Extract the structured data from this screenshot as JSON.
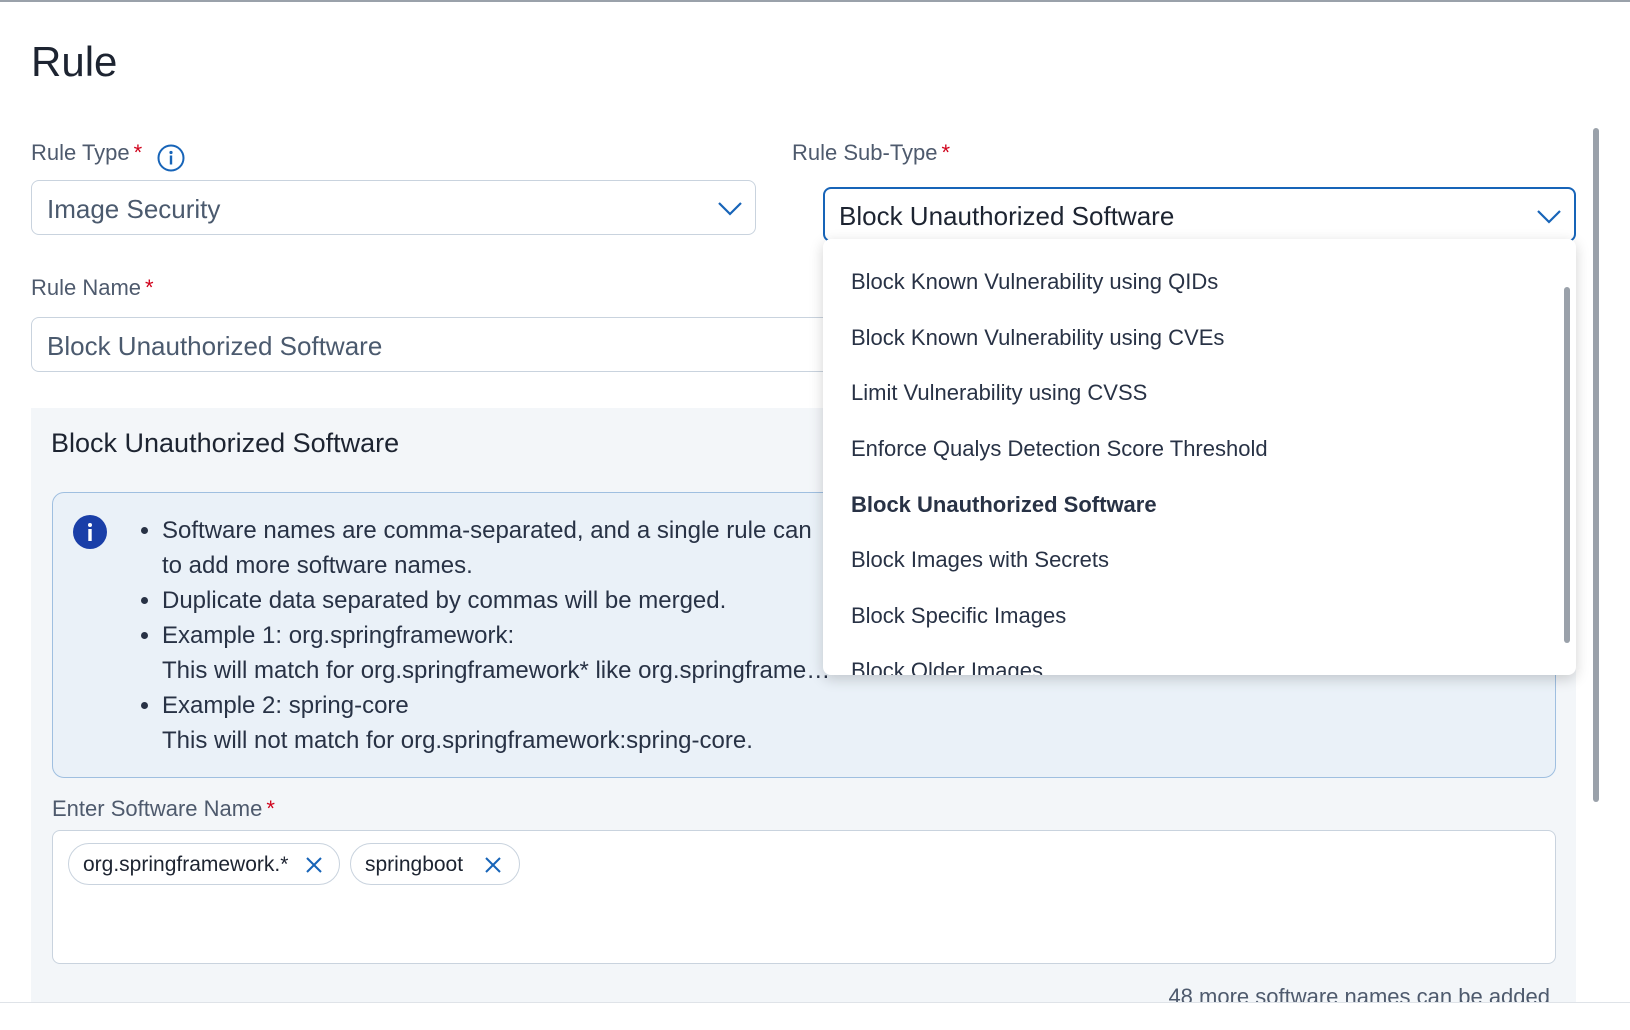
{
  "page": {
    "title": "Rule"
  },
  "rule_type": {
    "label": "Rule Type",
    "required_mark": "*",
    "value": "Image Security"
  },
  "rule_sub_type": {
    "label": "Rule Sub-Type",
    "required_mark": "*",
    "value": "Block Unauthorized Software"
  },
  "rule_name": {
    "label": "Rule Name",
    "required_mark": "*",
    "value": "Block Unauthorized Software"
  },
  "dropdown": {
    "options": [
      "Block Known Vulnerability using QIDs",
      "Block Known Vulnerability using CVEs",
      "Limit Vulnerability using CVSS",
      "Enforce Qualys Detection Score Threshold",
      "Block Unauthorized Software",
      "Block Images with Secrets",
      "Block Specific Images",
      "Block Older Images"
    ],
    "selected": "Block Unauthorized Software"
  },
  "panel": {
    "title": "Block Unauthorized Software",
    "notice_lines": [
      "Software names are comma-separated, and a single rule can",
      "to add more software names.",
      "Duplicate data separated by commas will be merged.",
      "Example 1: org.springframework:",
      "This will match for org.springframework* like org.springframe…",
      "Example 2: spring-core",
      "This will not match for org.springframework:spring-core."
    ]
  },
  "software": {
    "label": "Enter Software Name",
    "required_mark": "*",
    "chips": [
      "org.springframework.*",
      "springboot"
    ],
    "remaining_text": "48 more software names can be added"
  },
  "colors": {
    "accent": "#1764b8",
    "required": "#d0021b",
    "info_icon": "#1a3fa8"
  }
}
